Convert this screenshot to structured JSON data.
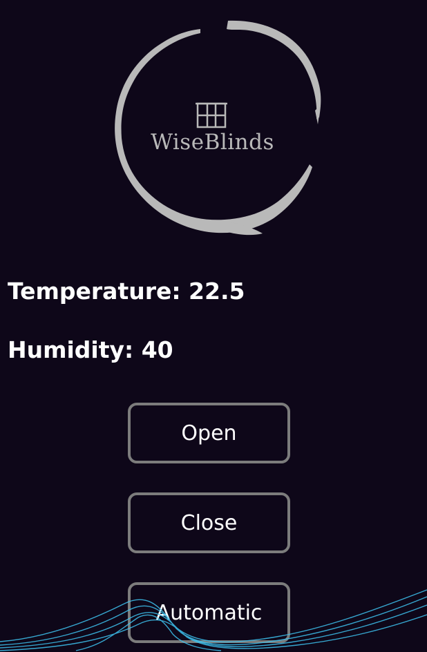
{
  "app": {
    "logo_text": "WiseBlinds"
  },
  "readings": {
    "temperature": "Temperature: 22.5",
    "humidity": "Humidity: 40"
  },
  "buttons": {
    "open": "Open",
    "close": "Close",
    "automatic": "Automatic"
  },
  "colors": {
    "background": "#0e0719",
    "logo": "#b9b9b9",
    "button_border": "#7c7c7c",
    "wave": "#3ec3f0"
  },
  "icons": {
    "logo_ring": "brush-circle-icon",
    "logo_window": "window-icon",
    "decoration": "wave-lines"
  }
}
